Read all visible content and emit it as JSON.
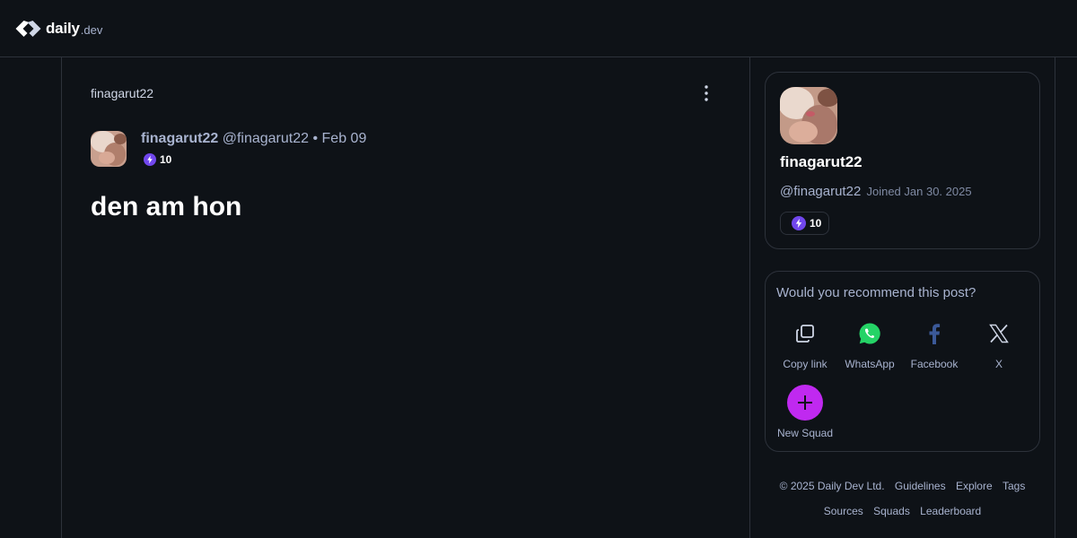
{
  "header": {
    "logo_text": "daily",
    "logo_tld": ".dev",
    "logo_icon": "daily-dev-logo-icon"
  },
  "post": {
    "breadcrumb": "finagarut22",
    "menu_icon": "more-vertical-icon",
    "author": {
      "name": "finagarut22",
      "handle": "@finagarut22",
      "separator": "•",
      "date": "Feb 09",
      "reputation": "10",
      "avatar_icon": "user-avatar-image"
    },
    "title": "den am hon"
  },
  "profile": {
    "name": "finagarut22",
    "handle": "@finagarut22",
    "joined": "Joined Jan 30. 2025",
    "reputation": "10",
    "reputation_icon": "reputation-bolt-icon",
    "accent_color": "#7147ed"
  },
  "share": {
    "title": "Would you recommend this post?",
    "items": [
      {
        "label": "Copy link",
        "icon": "copy-link-icon"
      },
      {
        "label": "WhatsApp",
        "icon": "whatsapp-icon",
        "color": "#25d366"
      },
      {
        "label": "Facebook",
        "icon": "facebook-icon",
        "color": "#3b5998"
      },
      {
        "label": "X",
        "icon": "x-icon"
      },
      {
        "label": "New Squad",
        "icon": "plus-icon",
        "color": "#c029f0"
      }
    ]
  },
  "footer": {
    "copyright": "© 2025 Daily Dev Ltd.",
    "links": [
      "Guidelines",
      "Explore",
      "Tags",
      "Sources",
      "Squads",
      "Leaderboard"
    ]
  }
}
